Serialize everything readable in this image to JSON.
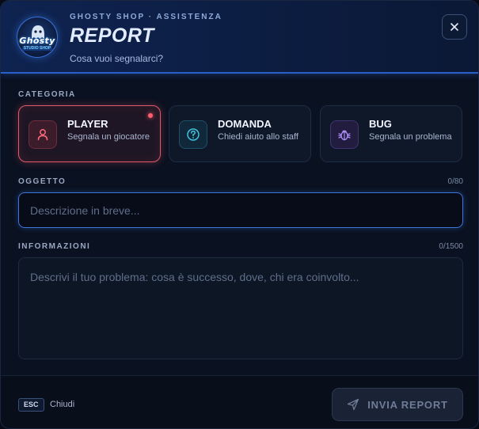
{
  "header": {
    "logo_text_1": "Ghosty",
    "logo_text_2": "STUDIO SHOP",
    "brand": "GHOSTY SHOP · ASSISTENZA",
    "title": "REPORT",
    "subtitle": "Cosa vuoi segnalarci?",
    "close_icon": "close-icon"
  },
  "category": {
    "label": "CATEGORIA",
    "selected": "PLAYER",
    "items": [
      {
        "title": "PLAYER",
        "desc": "Segnala un giocatore",
        "icon": "user-icon",
        "color": "#e25a6a"
      },
      {
        "title": "DOMANDA",
        "desc": "Chiedi aiuto allo staff",
        "icon": "question-icon",
        "color": "#3fc4e0"
      },
      {
        "title": "BUG",
        "desc": "Segnala un problema",
        "icon": "bug-icon",
        "color": "#9b7ff0"
      }
    ]
  },
  "subject": {
    "label": "OGGETTO",
    "counter": "0/80",
    "value": "",
    "placeholder": "Descrizione in breve..."
  },
  "details": {
    "label": "INFORMAZIONI",
    "counter": "0/1500",
    "value": "",
    "placeholder": "Descrivi il tuo problema: cosa è successo, dove, chi era coinvolto..."
  },
  "footer": {
    "esc_key": "ESC",
    "esc_label": "Chiudi",
    "submit_label": "INVIA REPORT",
    "submit_icon": "send-icon"
  },
  "colors": {
    "accent": "#3f74d9",
    "active": "#e25a6a"
  }
}
